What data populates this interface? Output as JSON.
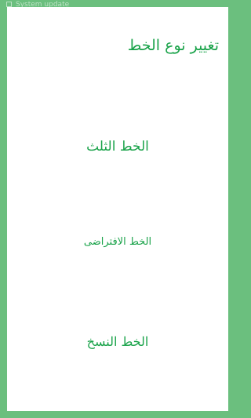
{
  "status_bar": {
    "icon": "notification-square-icon",
    "text": "System update"
  },
  "dialog": {
    "title": "تغيير نوع الخط",
    "options": [
      {
        "label": "الخط الثلث"
      },
      {
        "label": "الخط الافتراضى"
      },
      {
        "label": "الخط النسخ"
      }
    ]
  },
  "colors": {
    "background": "#6bbf7e",
    "dialog": "#ffffff",
    "accent": "#1aa34a"
  }
}
